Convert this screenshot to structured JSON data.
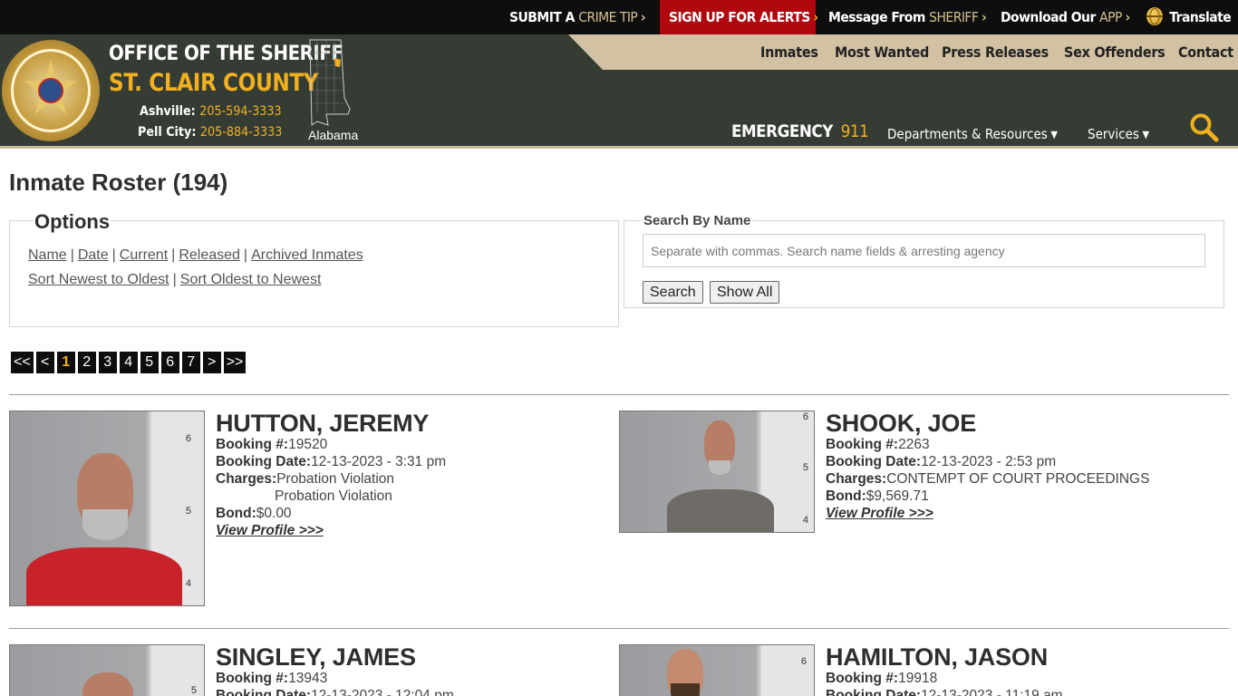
{
  "topbar": {
    "crime_tip_a": "SUBMIT A",
    "crime_tip_b": "CRIME TIP",
    "alerts": "SIGN UP FOR ALERTS",
    "message_a": "Message From",
    "message_b": "SHERIFF",
    "download_a": "Download Our",
    "download_b": "APP",
    "translate": "Translate",
    "chevron": "›"
  },
  "header": {
    "office": "OFFICE OF THE SHERIFF",
    "county": "ST. CLAIR COUNTY",
    "ashville_label": "Ashville:",
    "ashville_phone": "205-594-3333",
    "pell_label": "Pell City:",
    "pell_phone": "205-884-3333",
    "map_label": "Alabama",
    "emergency_label": "EMERGENCY",
    "emergency_num": "911"
  },
  "nav": {
    "main": [
      "Inmates",
      "Most Wanted",
      "Press Releases",
      "Sex Offenders",
      "Contact"
    ],
    "departments": "Departments & Resources",
    "services": "Services"
  },
  "page": {
    "title": "Inmate Roster (194)"
  },
  "options": {
    "title": "Options",
    "filters": [
      "Name",
      "Date",
      "Current",
      "Released",
      "Archived Inmates"
    ],
    "sorts": [
      "Sort Newest to Oldest",
      "Sort Oldest to Newest"
    ],
    "separator": "|"
  },
  "search": {
    "label": "Search By Name",
    "placeholder": "Separate with commas. Search name fields & arresting agency",
    "search_button": "Search",
    "show_all_button": "Show All"
  },
  "pager": [
    "<<",
    "<",
    "1",
    "2",
    "3",
    "4",
    "5",
    "6",
    "7",
    ">",
    ">>"
  ],
  "labels": {
    "booking_no": "Booking #:",
    "booking_date": "Booking Date:",
    "charges": "Charges:",
    "bond": "Bond:",
    "view_profile": "View Profile >>>"
  },
  "inmates": [
    {
      "name": "HUTTON, JEREMY",
      "booking_no": "19520",
      "booking_date": "12-13-2023 - 3:31 pm",
      "charges": [
        "Probation Violation",
        "Probation Violation"
      ],
      "bond": "$0.00",
      "ruler_marks": [
        "6",
        "5",
        "4"
      ]
    },
    {
      "name": "SHOOK, JOE",
      "booking_no": "2263",
      "booking_date": "12-13-2023 - 2:53 pm",
      "charges": [
        "CONTEMPT OF COURT PROCEEDINGS"
      ],
      "bond": "$9,569.71",
      "ruler_marks": [
        "6",
        "5",
        "4"
      ]
    },
    {
      "name": "SINGLEY, JAMES",
      "booking_no": "13943",
      "booking_date": "12-13-2023 - 12:04 pm",
      "ruler_marks": [
        "5"
      ]
    },
    {
      "name": "HAMILTON, JASON",
      "booking_no": "19918",
      "booking_date": "12-13-2023 - 11:19 am",
      "ruler_marks": [
        "6"
      ]
    }
  ],
  "colors": {
    "topbar": "#0e0e0e",
    "alerts_red": "#b0080f",
    "header_green": "#353c33",
    "gold": "#f0b020",
    "tan": "#d2c1a3"
  }
}
